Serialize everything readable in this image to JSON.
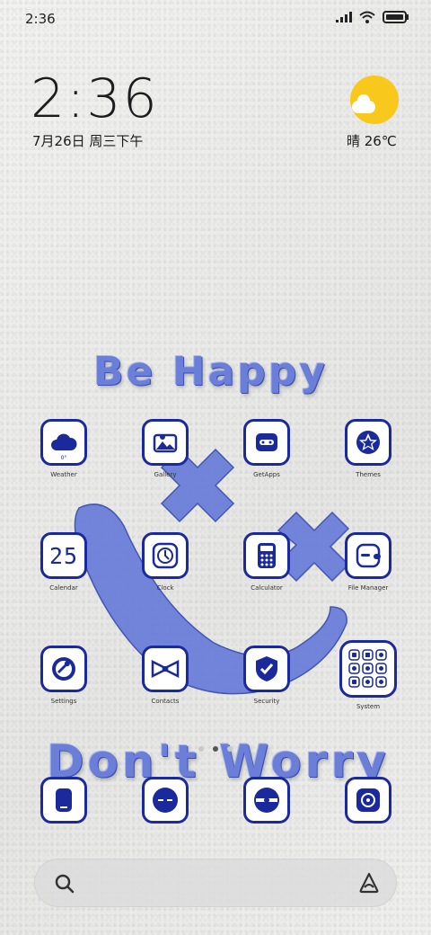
{
  "status_bar": {
    "time": "2:36"
  },
  "lock_widget": {
    "clock": "2:36",
    "date": "7月26日 周三下午",
    "weather": "晴 26℃"
  },
  "wallpaper": {
    "top_text": "Be Happy",
    "bottom_text": "Don't Worry",
    "accent_color": "#1a2a9c"
  },
  "apps": {
    "weather": {
      "label": "Weather",
      "temp": "0°"
    },
    "gallery": {
      "label": "Gallery"
    },
    "getapps": {
      "label": "GetApps"
    },
    "themes": {
      "label": "Themes"
    },
    "calendar": {
      "label": "Calendar",
      "day": "25"
    },
    "clock": {
      "label": "Clock"
    },
    "calculator": {
      "label": "Calculator"
    },
    "file_manager": {
      "label": "File Manager"
    },
    "settings": {
      "label": "Settings"
    },
    "contacts": {
      "label": "Contacts"
    },
    "security": {
      "label": "Security"
    },
    "system": {
      "label": "System"
    }
  },
  "dock": [
    "phone-icon",
    "messages-icon",
    "browser-icon",
    "camera-icon"
  ],
  "page_indicator": {
    "count": 3,
    "active": 2
  }
}
